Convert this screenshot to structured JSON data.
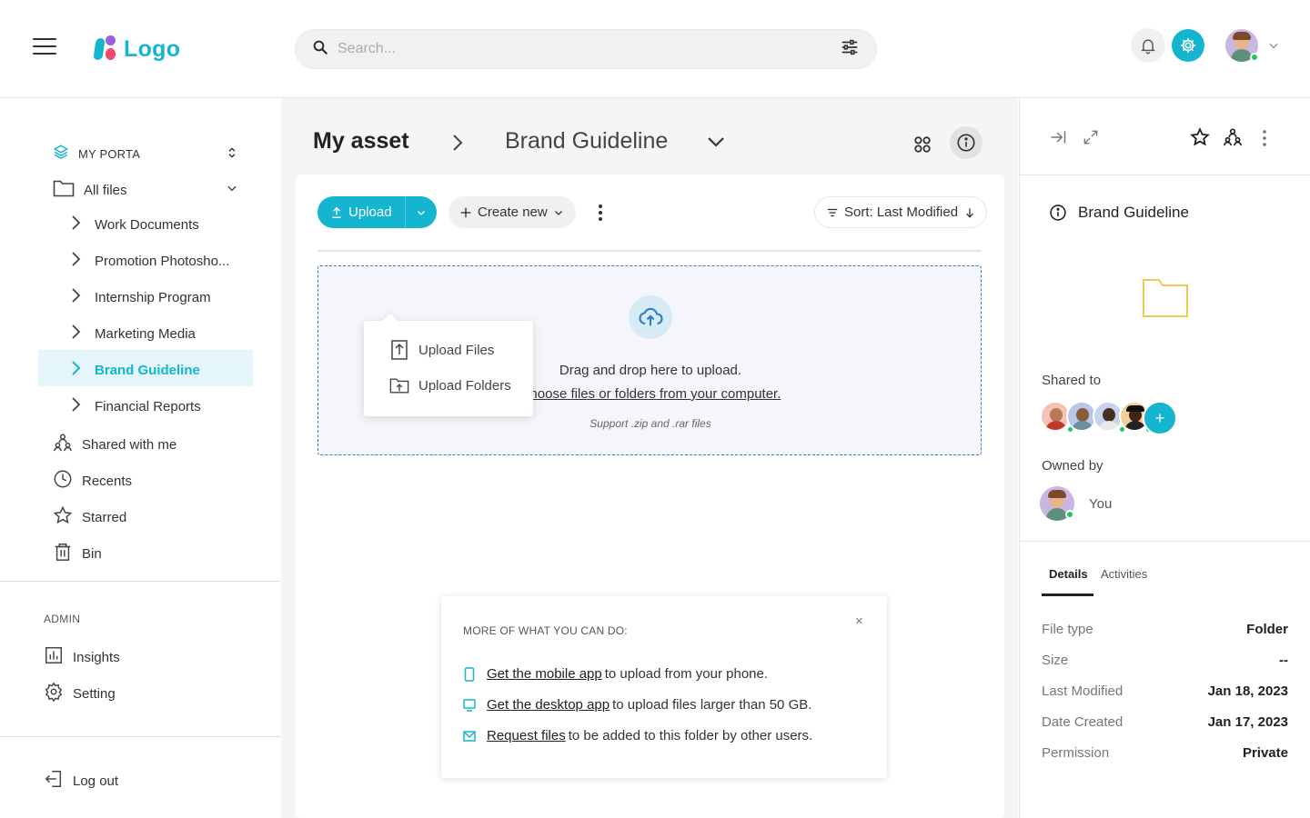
{
  "header": {
    "logo_text": "Logo",
    "search_placeholder": "Search..."
  },
  "sidebar": {
    "portal_label": "MY PORTA",
    "all_files": "All files",
    "folders": [
      {
        "label": "Work Documents"
      },
      {
        "label": "Promotion Photosho..."
      },
      {
        "label": "Internship Program"
      },
      {
        "label": "Marketing Media"
      },
      {
        "label": "Brand Guideline"
      },
      {
        "label": "Financial Reports"
      }
    ],
    "shared": "Shared with me",
    "recents": "Recents",
    "starred": "Starred",
    "bin": "Bin",
    "admin_heading": "ADMIN",
    "insights": "Insights",
    "setting": "Setting",
    "logout": "Log out"
  },
  "main": {
    "breadcrumb_root": "My asset",
    "breadcrumb_current": "Brand Guideline",
    "upload_label": "Upload",
    "create_label": "Create new",
    "sort_label": "Sort: Last Modified",
    "menu": {
      "upload_files": "Upload Files",
      "upload_folders": "Upload Folders"
    },
    "dropzone": {
      "line1": "Drag and drop here to upload.",
      "line2": "Choose files or folders from your computer.",
      "line3": "Support .zip and .rar files"
    },
    "tips": {
      "title": "MORE OF WHAT YOU CAN DO:",
      "rows": [
        {
          "link": "Get the mobile app",
          "text": "to upload from your phone."
        },
        {
          "link": "Get the desktop app",
          "text": "to upload files larger than 50 GB."
        },
        {
          "link": "Request files",
          "text": "to be added to this folder by other users."
        }
      ],
      "close": "×"
    }
  },
  "panel": {
    "title": "Brand Guideline",
    "shared_to": "Shared to",
    "add_symbol": "+",
    "owned_by": "Owned by",
    "owner": "You",
    "tabs": [
      "Details",
      "Activities"
    ],
    "details": [
      {
        "label": "File type",
        "value": "Folder"
      },
      {
        "label": "Size",
        "value": "--"
      },
      {
        "label": "Last Modified",
        "value": "Jan 18, 2023"
      },
      {
        "label": "Date Created",
        "value": "Jan 17, 2023"
      },
      {
        "label": "Permission",
        "value": "Private"
      }
    ]
  },
  "colors": {
    "accent": "#15b4d0",
    "active_bg": "#e4f6fa",
    "dropzone_border": "#2d7fc6",
    "folder_icon": "#f0c84c",
    "online": "#22c55e"
  },
  "icons": [
    "hamburger-icon",
    "search-icon",
    "filter-icon",
    "bell-icon",
    "gear-icon",
    "chevron-down-icon",
    "chevron-right-icon",
    "layers-icon",
    "folder-icon",
    "shared-icon",
    "clock-icon",
    "star-icon",
    "trash-icon",
    "insights-icon",
    "setting-icon",
    "logout-icon",
    "grid-icon",
    "info-icon",
    "upload-icon",
    "plus-icon",
    "more-vertical-icon",
    "sort-icon",
    "arrow-down-icon",
    "cloud-upload-icon",
    "upload-file-icon",
    "upload-folder-icon",
    "phone-icon",
    "monitor-icon",
    "mail-icon",
    "close-icon",
    "collapse-panel-icon",
    "expand-icon"
  ]
}
